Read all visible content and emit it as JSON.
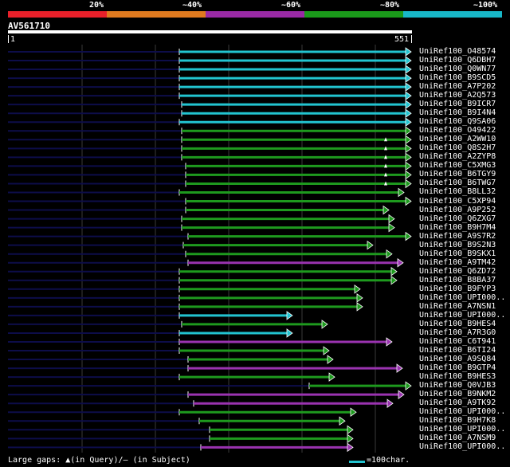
{
  "legend": {
    "colors": [
      "#e8202a",
      "#e07a1f",
      "#9a2aa5",
      "#1a9a1a",
      "#18b8c8"
    ],
    "labels": [
      "20%",
      "~40%",
      "~60%",
      "~80%",
      "~100%"
    ]
  },
  "query": {
    "id": "AV561710",
    "start": "1",
    "end": "551"
  },
  "colors": {
    "cyan": "#22c4d0",
    "green": "#1e9a1e",
    "purple": "#9a33b0",
    "navy": "#0d0d4a",
    "grid": "#3a3a3a"
  },
  "hits": [
    {
      "label": "UniRef100_O48574",
      "color": "cyan",
      "start": 225,
      "end": 516
    },
    {
      "label": "UniRef100_Q6DBH7",
      "color": "cyan",
      "start": 225,
      "end": 516
    },
    {
      "label": "UniRef100_Q0WN77",
      "color": "cyan",
      "start": 225,
      "end": 516
    },
    {
      "label": "UniRef100_B9SCD5",
      "color": "cyan",
      "start": 225,
      "end": 516
    },
    {
      "label": "UniRef100_A7P202",
      "color": "cyan",
      "start": 225,
      "end": 516
    },
    {
      "label": "UniRef100_A2Q573",
      "color": "cyan",
      "start": 225,
      "end": 516
    },
    {
      "label": "UniRef100_B9ICR7",
      "color": "cyan",
      "start": 228,
      "end": 516
    },
    {
      "label": "UniRef100_B9I4N4",
      "color": "cyan",
      "start": 228,
      "end": 516
    },
    {
      "label": "UniRef100_Q9SA06",
      "color": "cyan",
      "start": 225,
      "end": 516
    },
    {
      "label": "UniRef100_O49422",
      "color": "green",
      "start": 228,
      "end": 516
    },
    {
      "label": "UniRef100_A2WW10",
      "color": "green",
      "start": 228,
      "end": 516,
      "gap": true
    },
    {
      "label": "UniRef100_Q8S2H7",
      "color": "green",
      "start": 228,
      "end": 516,
      "gap": true
    },
    {
      "label": "UniRef100_A2ZYP8",
      "color": "green",
      "start": 228,
      "end": 516,
      "gap": true
    },
    {
      "label": "UniRef100_C5XMG3",
      "color": "green",
      "start": 233,
      "end": 516,
      "gap": true
    },
    {
      "label": "UniRef100_B6TGY9",
      "color": "green",
      "start": 233,
      "end": 516,
      "gap": true
    },
    {
      "label": "UniRef100_B6TWG7",
      "color": "green",
      "start": 233,
      "end": 516,
      "gap": true
    },
    {
      "label": "UniRef100_B8LL32",
      "color": "green",
      "start": 225,
      "end": 507
    },
    {
      "label": "UniRef100_C5XP94",
      "color": "green",
      "start": 233,
      "end": 516
    },
    {
      "label": "UniRef100_A9P252",
      "color": "green",
      "start": 233,
      "end": 488
    },
    {
      "label": "UniRef100_Q6ZXG7",
      "color": "green",
      "start": 228,
      "end": 495
    },
    {
      "label": "UniRef100_B9H7M4",
      "color": "green",
      "start": 228,
      "end": 495
    },
    {
      "label": "UniRef100_A9S7R2",
      "color": "green",
      "start": 236,
      "end": 516
    },
    {
      "label": "UniRef100_B9S2N3",
      "color": "green",
      "start": 230,
      "end": 468
    },
    {
      "label": "UniRef100_B9SKX1",
      "color": "green",
      "start": 233,
      "end": 492
    },
    {
      "label": "UniRef100_A9TM42",
      "color": "purple",
      "start": 236,
      "end": 506
    },
    {
      "label": "UniRef100_Q6ZD72",
      "color": "green",
      "start": 225,
      "end": 498
    },
    {
      "label": "UniRef100_B8BA37",
      "color": "green",
      "start": 225,
      "end": 498
    },
    {
      "label": "UniRef100_B9FYP3",
      "color": "green",
      "start": 225,
      "end": 452
    },
    {
      "label": "UniRef100_UPI000..",
      "color": "green",
      "start": 225,
      "end": 455
    },
    {
      "label": "UniRef100_A7NSN1",
      "color": "green",
      "start": 225,
      "end": 455
    },
    {
      "label": "UniRef100_UPI000..",
      "color": "cyan",
      "start": 225,
      "end": 367
    },
    {
      "label": "UniRef100_B9HES4",
      "color": "green",
      "start": 228,
      "end": 411
    },
    {
      "label": "UniRef100_A7R3G0",
      "color": "cyan",
      "start": 225,
      "end": 367
    },
    {
      "label": "UniRef100_C6T941",
      "color": "purple",
      "start": 225,
      "end": 492
    },
    {
      "label": "UniRef100_B6TI24",
      "color": "green",
      "start": 225,
      "end": 413
    },
    {
      "label": "UniRef100_A9SQ84",
      "color": "green",
      "start": 236,
      "end": 418
    },
    {
      "label": "UniRef100_B9GTP4",
      "color": "purple",
      "start": 236,
      "end": 505
    },
    {
      "label": "UniRef100_B9HES3",
      "color": "green",
      "start": 225,
      "end": 420
    },
    {
      "label": "UniRef100_Q0VJB3",
      "color": "green",
      "start": 388,
      "end": 516
    },
    {
      "label": "UniRef100_B9NKM2",
      "color": "purple",
      "start": 236,
      "end": 507
    },
    {
      "label": "UniRef100_A9TK92",
      "color": "purple",
      "start": 243,
      "end": 493
    },
    {
      "label": "UniRef100_UPI000..",
      "color": "green",
      "start": 225,
      "end": 447
    },
    {
      "label": "UniRef100_B9H7K8",
      "color": "green",
      "start": 250,
      "end": 433
    },
    {
      "label": "UniRef100_UPI000..",
      "color": "green",
      "start": 263,
      "end": 443
    },
    {
      "label": "UniRef100_A7NSM9",
      "color": "green",
      "start": 263,
      "end": 443
    },
    {
      "label": "UniRef100_UPI000..",
      "color": "purple",
      "start": 252,
      "end": 443
    }
  ],
  "footer": {
    "gaps_text": "Large gaps: ▲(in Query)/— (in Subject)",
    "scale_text": "=100char."
  }
}
